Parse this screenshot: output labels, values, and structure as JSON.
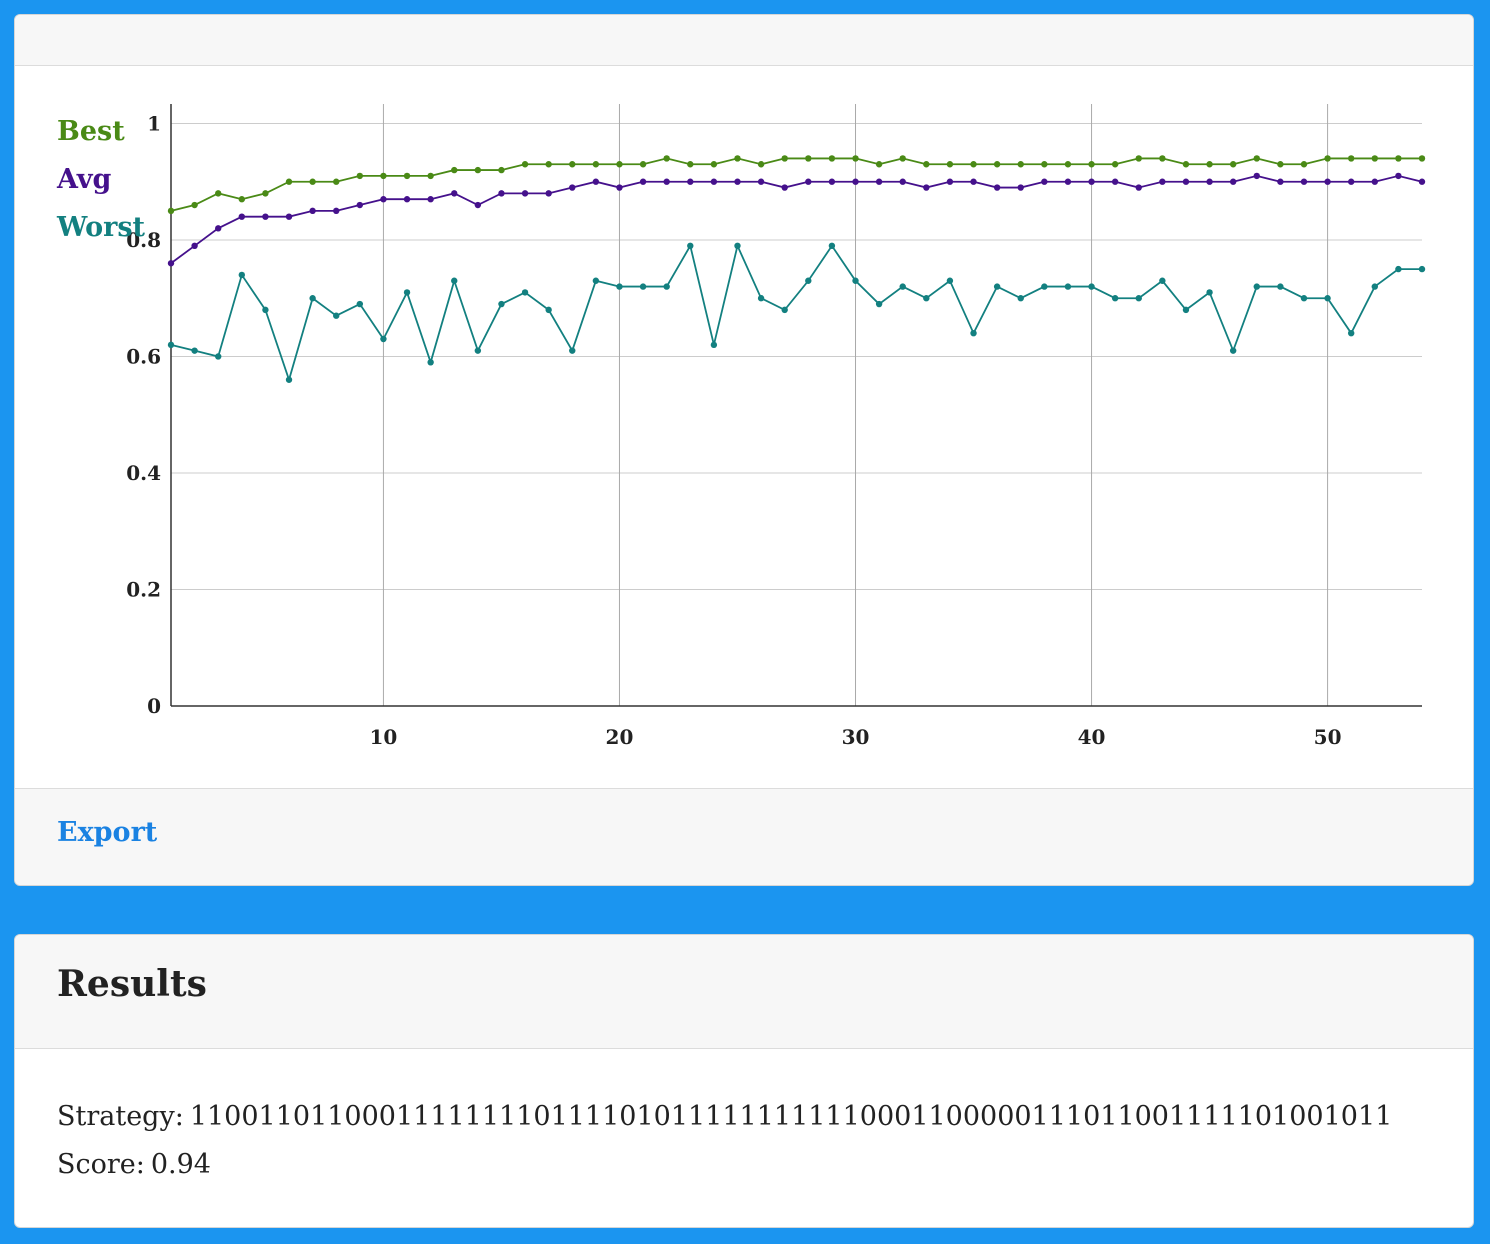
{
  "chart_card": {
    "export_label": "Export"
  },
  "results": {
    "title": "Results",
    "strategy_label": "Strategy:",
    "strategy_value": "1100110110001111111101111010111111111110001100000111011001111101001011",
    "score_label": "Score:",
    "score_value": "0.94"
  },
  "chart_data": {
    "type": "line",
    "x": [
      1,
      2,
      3,
      4,
      5,
      6,
      7,
      8,
      9,
      10,
      11,
      12,
      13,
      14,
      15,
      16,
      17,
      18,
      19,
      20,
      21,
      22,
      23,
      24,
      25,
      26,
      27,
      28,
      29,
      30,
      31,
      32,
      33,
      34,
      35,
      36,
      37,
      38,
      39,
      40,
      41,
      42,
      43,
      44,
      45,
      46,
      47,
      48,
      49,
      50,
      51,
      52,
      53,
      54
    ],
    "xlim": [
      1,
      54
    ],
    "ylim": [
      0,
      1.03
    ],
    "xticks": [
      10,
      20,
      30,
      40,
      50
    ],
    "xtick_labels": [
      "10",
      "20",
      "30",
      "40",
      "50"
    ],
    "yticks": [
      0,
      0.2,
      0.4,
      0.6,
      0.8,
      1
    ],
    "ytick_labels": [
      "0",
      "0.2",
      "0.4",
      "0.6",
      "0.8",
      "1"
    ],
    "grid": true,
    "legend_position": "top-left",
    "series": [
      {
        "name": "Best",
        "color": "#4a8a16",
        "values": [
          0.85,
          0.86,
          0.88,
          0.87,
          0.88,
          0.9,
          0.9,
          0.9,
          0.91,
          0.91,
          0.91,
          0.91,
          0.92,
          0.92,
          0.92,
          0.93,
          0.93,
          0.93,
          0.93,
          0.93,
          0.93,
          0.94,
          0.93,
          0.93,
          0.94,
          0.93,
          0.94,
          0.94,
          0.94,
          0.94,
          0.93,
          0.94,
          0.93,
          0.93,
          0.93,
          0.93,
          0.93,
          0.93,
          0.93,
          0.93,
          0.93,
          0.94,
          0.94,
          0.93,
          0.93,
          0.93,
          0.94,
          0.93,
          0.93,
          0.94,
          0.94,
          0.94,
          0.94,
          0.94
        ]
      },
      {
        "name": "Avg",
        "color": "#45118c",
        "values": [
          0.76,
          0.79,
          0.82,
          0.84,
          0.84,
          0.84,
          0.85,
          0.85,
          0.86,
          0.87,
          0.87,
          0.87,
          0.88,
          0.86,
          0.88,
          0.88,
          0.88,
          0.89,
          0.9,
          0.89,
          0.9,
          0.9,
          0.9,
          0.9,
          0.9,
          0.9,
          0.89,
          0.9,
          0.9,
          0.9,
          0.9,
          0.9,
          0.89,
          0.9,
          0.9,
          0.89,
          0.89,
          0.9,
          0.9,
          0.9,
          0.9,
          0.89,
          0.9,
          0.9,
          0.9,
          0.9,
          0.91,
          0.9,
          0.9,
          0.9,
          0.9,
          0.9,
          0.91,
          0.9
        ]
      },
      {
        "name": "Worst",
        "color": "#138080",
        "values": [
          0.62,
          0.61,
          0.6,
          0.74,
          0.68,
          0.56,
          0.7,
          0.67,
          0.69,
          0.63,
          0.71,
          0.59,
          0.73,
          0.61,
          0.69,
          0.71,
          0.68,
          0.61,
          0.73,
          0.72,
          0.72,
          0.72,
          0.79,
          0.62,
          0.79,
          0.7,
          0.68,
          0.73,
          0.79,
          0.73,
          0.69,
          0.72,
          0.7,
          0.73,
          0.64,
          0.72,
          0.7,
          0.72,
          0.72,
          0.72,
          0.7,
          0.7,
          0.73,
          0.68,
          0.71,
          0.61,
          0.72,
          0.72,
          0.7,
          0.7,
          0.64,
          0.72,
          0.75,
          0.75
        ]
      }
    ]
  }
}
